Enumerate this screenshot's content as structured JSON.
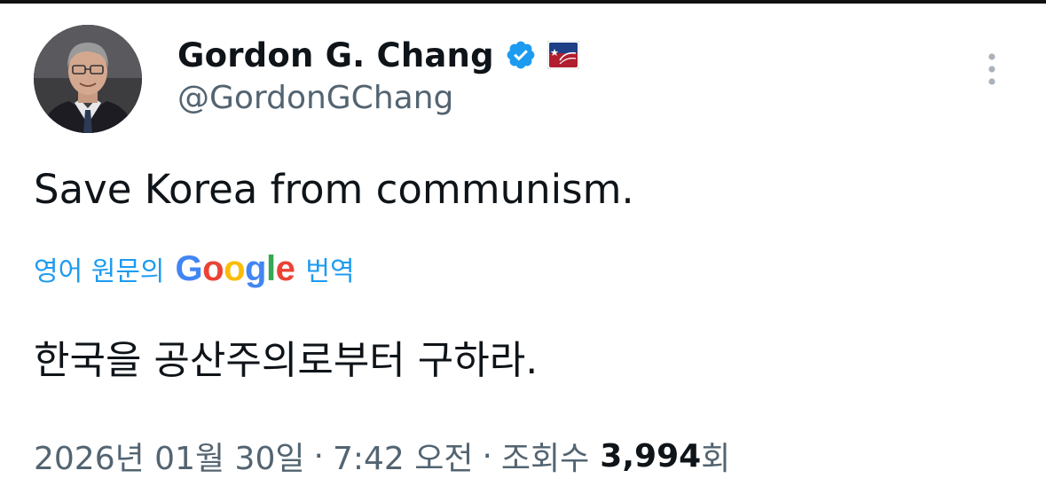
{
  "author": {
    "display_name": "Gordon G. Chang",
    "handle": "@GordonGChang"
  },
  "tweet": {
    "text": "Save Korea from communism."
  },
  "translation": {
    "prefix": "영어 원문의",
    "provider_letters": [
      "G",
      "o",
      "o",
      "g",
      "l",
      "e"
    ],
    "provider_colors": [
      "#4285F4",
      "#EA4335",
      "#FBBC05",
      "#4285F4",
      "#34A853",
      "#EA4335"
    ],
    "suffix": "번역",
    "text": "한국을 공산주의로부터 구하라."
  },
  "meta": {
    "date": "2026년 01월 30일",
    "separator": "·",
    "time": "7:42 오전",
    "views_label": "조회수",
    "views_count": "3,994",
    "views_suffix": "회"
  },
  "icons": {
    "verified": "verified-badge-icon",
    "affiliate": "affiliate-logo-icon",
    "more": "more-vertical-icon"
  },
  "colors": {
    "link": "#1d9bf0",
    "verified": "#1d9bf0",
    "secondary_text": "#536471",
    "primary_text": "#0f1419"
  }
}
